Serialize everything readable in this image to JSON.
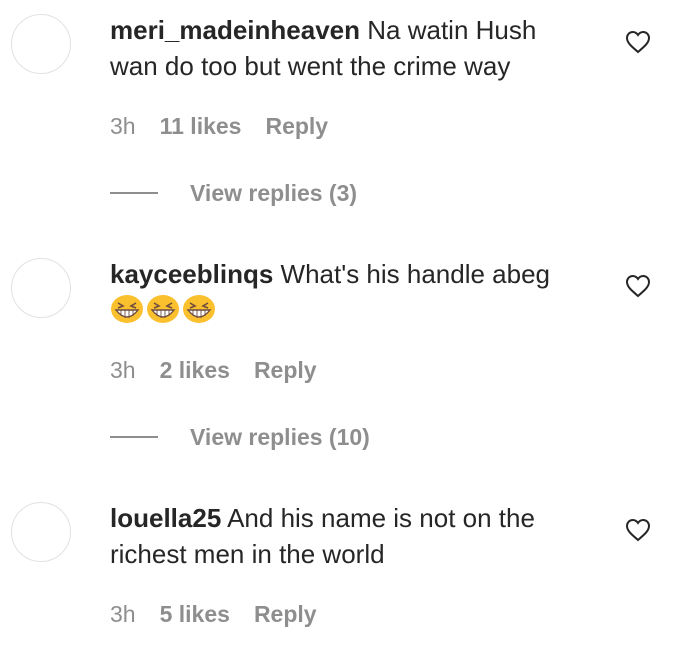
{
  "comments": [
    {
      "username": "meri_madeinheaven",
      "text": "Na watin Hush wan do too but went the crime way",
      "time": "3h",
      "likes": "11 likes",
      "reply": "Reply",
      "view_replies": "View replies (3)",
      "icon": "heart-outline-icon"
    },
    {
      "username": "kayceeblinqs",
      "text": "What's his handle abeg",
      "emoji": [
        "grinning-squinting-face",
        "grinning-squinting-face",
        "grinning-squinting-face"
      ],
      "time": "3h",
      "likes": "2 likes",
      "reply": "Reply",
      "view_replies": "View replies (10)",
      "icon": "heart-outline-icon"
    },
    {
      "username": "louella25",
      "text": "And his name is not on the richest men in the world",
      "time": "3h",
      "likes": "5 likes",
      "reply": "Reply",
      "icon": "heart-outline-icon"
    }
  ],
  "colors": {
    "text": "#262626",
    "secondary": "#8e8e8e",
    "emoji": "#fbc02d"
  }
}
